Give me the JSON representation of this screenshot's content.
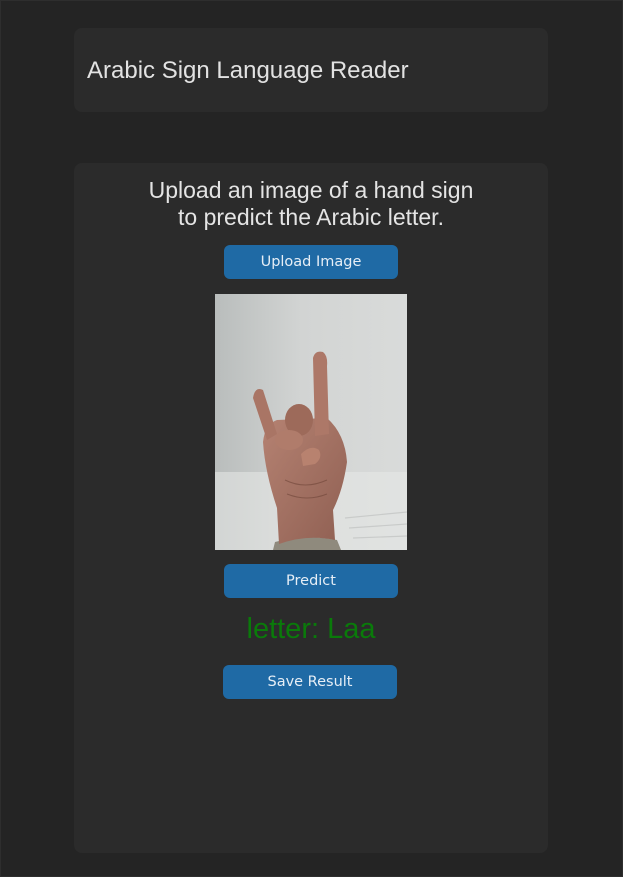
{
  "app": {
    "title": "Arabic Sign Language Reader"
  },
  "main": {
    "instruction_line1": "Upload an image of a hand sign",
    "instruction_line2": "to predict the Arabic letter.",
    "upload_label": "Upload Image",
    "predict_label": "Predict",
    "result_text": "letter: Laa",
    "save_label": "Save Result"
  },
  "colors": {
    "background": "#242424",
    "card": "#2b2b2b",
    "button": "#1f6aa5",
    "result_text": "#0a7a0a"
  }
}
